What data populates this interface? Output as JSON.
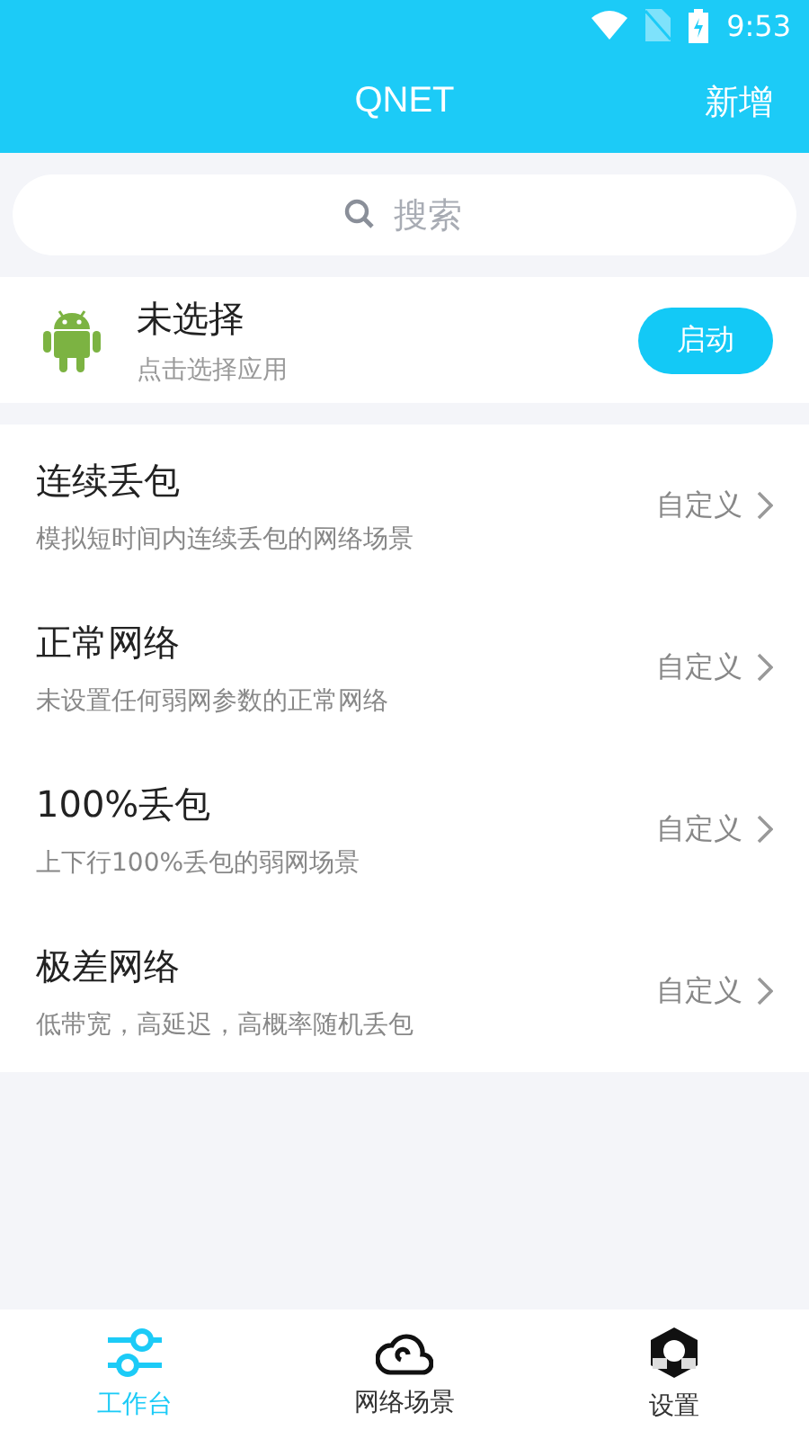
{
  "status_bar": {
    "time": "9:53"
  },
  "header": {
    "title": "QNET",
    "action": "新增"
  },
  "search": {
    "placeholder": "搜索"
  },
  "app": {
    "name": "未选择",
    "hint": "点击选择应用",
    "button": "启动"
  },
  "scenarios": [
    {
      "title": "连续丢包",
      "description": "模拟短时间内连续丢包的网络场景",
      "action": "自定义"
    },
    {
      "title": "正常网络",
      "description": "未设置任何弱网参数的正常网络",
      "action": "自定义"
    },
    {
      "title": "100%丢包",
      "description": "上下行100%丢包的弱网场景",
      "action": "自定义"
    },
    {
      "title": "极差网络",
      "description": "低带宽，高延迟，高概率随机丢包",
      "action": "自定义"
    }
  ],
  "tabs": [
    {
      "label": "工作台",
      "kind": "sliders",
      "selected": true
    },
    {
      "label": "网络场景",
      "kind": "cloud",
      "selected": false
    },
    {
      "label": "设置",
      "kind": "hexagon",
      "selected": false
    }
  ]
}
